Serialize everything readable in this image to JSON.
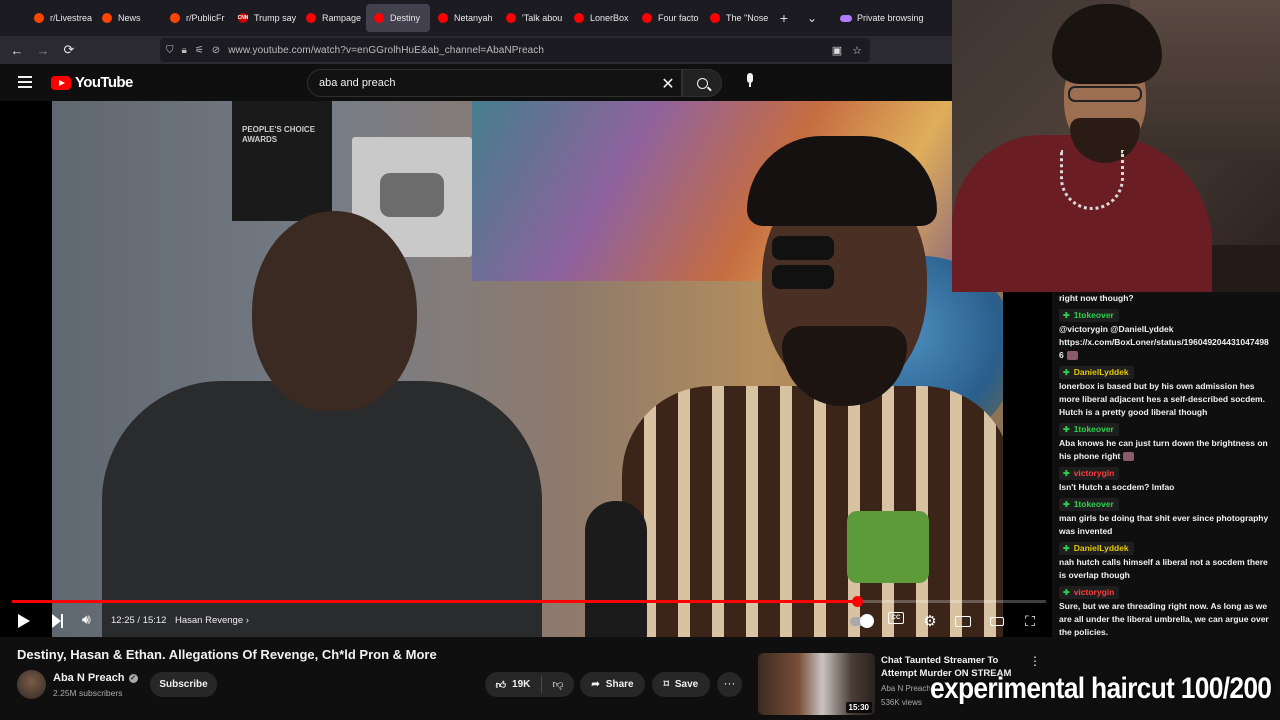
{
  "browser": {
    "tabs": [
      {
        "label": "r/Livestrea",
        "favicon_color": "#ff4500"
      },
      {
        "label": "News",
        "favicon_color": "#ff4500"
      },
      {
        "label": "r/PublicFr",
        "favicon_color": "#ff4500"
      },
      {
        "label": "Trump say",
        "favicon_color": "#cc0000",
        "favicon_text": "CNN"
      },
      {
        "label": "Rampage",
        "favicon_color": "#ff0000"
      },
      {
        "label": "Destiny",
        "favicon_color": "#ff0000",
        "active": true
      },
      {
        "label": "Netanyah",
        "favicon_color": "#ff0000"
      },
      {
        "label": "'Talk abou",
        "favicon_color": "#ff0000"
      },
      {
        "label": "LonerBox",
        "favicon_color": "#ff0000"
      },
      {
        "label": "Four facto",
        "favicon_color": "#ff0000"
      },
      {
        "label": "The \"Nose",
        "favicon_color": "#ff0000"
      }
    ],
    "new_tab_icon": "plus-icon",
    "tab_list_icon": "chevron-down-icon",
    "private_label": "Private browsing",
    "url": "www.youtube.com/watch?v=enGGrolhHuE&ab_channel=AbaNPreach"
  },
  "youtube": {
    "logo_text": "YouTube",
    "search_value": "aba and preach",
    "video": {
      "current_time": "12:25",
      "duration": "15:12",
      "time_display": "12:25 / 15:12",
      "chapter": "Hasan Revenge",
      "progress_fraction": 0.817,
      "poster_text": "PEOPLE'S CHOICE AWARDS"
    },
    "title": "Destiny, Hasan & Ethan. Allegations Of Revenge, Ch*ld Pron & More",
    "channel": {
      "name": "Aba N Preach",
      "subscribers": "2.25M subscribers",
      "verified_mark": "✓"
    },
    "actions": {
      "subscribe": "Subscribe",
      "likes": "19K",
      "share": "Share",
      "save": "Save",
      "more": "···"
    },
    "recommended": {
      "title": "Chat Taunted Streamer To Attempt Murder ON STREAM",
      "channel": "Aba N Preach",
      "views": "536K views",
      "duration": "15:30"
    }
  },
  "chat": {
    "messages": [
      {
        "user": "",
        "text": "right now though?"
      },
      {
        "user": "1tokeover",
        "user_color": "#2bd14a",
        "text": "@victorygin @DanielLyddek https://x.com/BoxLoner/status/1960492044310474986",
        "emote": true
      },
      {
        "user": "DanielLyddek",
        "user_color": "#e6c800",
        "text": "lonerbox is based but by his own admission hes more liberal adjacent hes a self-described socdem. Hutch is a pretty good liberal though"
      },
      {
        "user": "1tokeover",
        "user_color": "#2bd14a",
        "text": "Aba knows he can just turn down the brightness on his phone right",
        "emote": true
      },
      {
        "user": "victorygin",
        "user_color": "#ff3b3b",
        "text": "Isn't Hutch a socdem? lmfao"
      },
      {
        "user": "1tokeover",
        "user_color": "#2bd14a",
        "text": "man girls be doing that shit ever since photography was invented"
      },
      {
        "user": "DanielLyddek",
        "user_color": "#e6c800",
        "text": "nah hutch calls himself a liberal not a socdem there is overlap though"
      },
      {
        "user": "victorygin",
        "user_color": "#ff3b3b",
        "text": "Sure, but we are threading right now. As long as we are all under the liberal umbrella, we can argue over the policies."
      }
    ]
  },
  "overlay_caption": "experimental haircut 100/200"
}
